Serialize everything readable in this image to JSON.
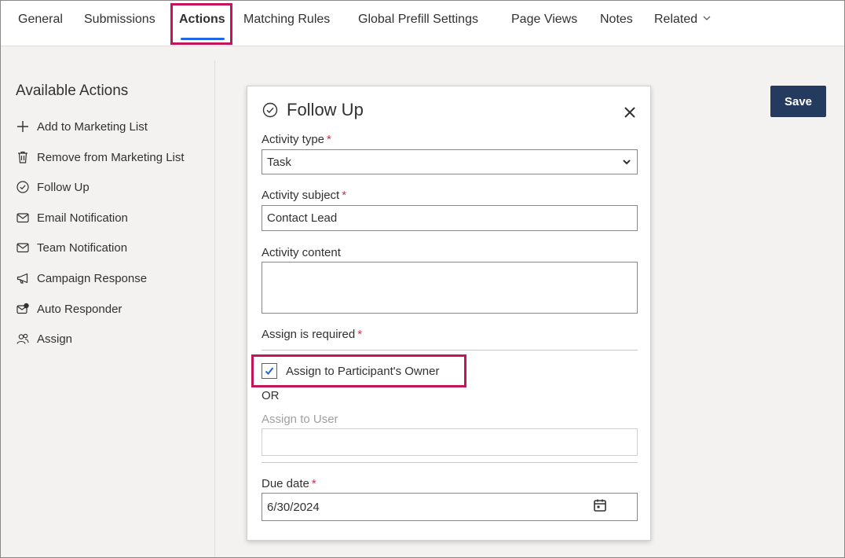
{
  "tabs": [
    {
      "label": "General"
    },
    {
      "label": "Submissions"
    },
    {
      "label": "Actions",
      "active": true
    },
    {
      "label": "Matching Rules"
    },
    {
      "label": "Global Prefill Settings"
    },
    {
      "label": "Page Views"
    },
    {
      "label": "Notes"
    },
    {
      "label": "Related"
    }
  ],
  "sidebar": {
    "title": "Available Actions",
    "items": [
      {
        "label": "Add to Marketing List",
        "icon": "plus-icon"
      },
      {
        "label": "Remove from Marketing List",
        "icon": "trash-icon"
      },
      {
        "label": "Follow Up",
        "icon": "check-circle-icon"
      },
      {
        "label": "Email Notification",
        "icon": "mail-icon"
      },
      {
        "label": "Team Notification",
        "icon": "mail-icon"
      },
      {
        "label": "Campaign Response",
        "icon": "megaphone-icon"
      },
      {
        "label": "Auto Responder",
        "icon": "mail-reply-icon"
      },
      {
        "label": "Assign",
        "icon": "people-icon"
      }
    ]
  },
  "toolbar": {
    "save_label": "Save"
  },
  "modal": {
    "title": "Follow Up",
    "activity_type": {
      "label": "Activity type",
      "value": "Task"
    },
    "activity_subject": {
      "label": "Activity subject",
      "value": "Contact Lead"
    },
    "activity_content": {
      "label": "Activity content",
      "value": ""
    },
    "assign_required_label": "Assign is required",
    "assign_owner": {
      "label": "Assign to Participant's Owner",
      "checked": true
    },
    "or_text": "OR",
    "assign_user": {
      "label": "Assign to User",
      "value": ""
    },
    "due_date": {
      "label": "Due date",
      "value": "6/30/2024"
    },
    "required_marker": "*"
  },
  "colors": {
    "accent": "#2266e3",
    "save_button": "#243a5e",
    "highlight": "#c4145a",
    "required": "#c4314b"
  }
}
